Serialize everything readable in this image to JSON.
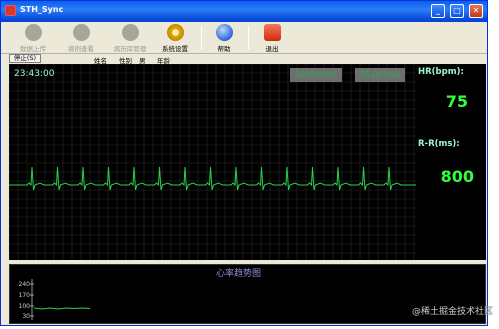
{
  "window": {
    "title": "STH_Sync"
  },
  "toolbar": {
    "items": [
      {
        "label": "数据上传",
        "icon": "upload-icon",
        "enabled": false
      },
      {
        "label": "病例查看",
        "icon": "records-icon",
        "enabled": false
      },
      {
        "label": "病历库管理",
        "icon": "users-icon",
        "enabled": false
      },
      {
        "label": "系统设置",
        "icon": "gear-icon",
        "enabled": true
      },
      {
        "label": "帮助",
        "icon": "help-icon",
        "enabled": true
      },
      {
        "label": "退出",
        "icon": "power-icon",
        "enabled": true
      }
    ]
  },
  "patient": {
    "stop_label": "停止(S)",
    "name_label": "姓名",
    "gender_label": "性别",
    "gender_value": "男",
    "age_label": "年龄"
  },
  "ecg": {
    "time": "23:43:00",
    "sweep_speed": "10mm/mV",
    "paper_speed": "25.0mm/s",
    "trace_color": "#2bd14c",
    "grid_color": "#2a2a2a"
  },
  "vitals": {
    "hr_label": "HR(bpm):",
    "hr_value": "75",
    "rr_label": "R-R(ms):",
    "rr_value": "800"
  },
  "trend": {
    "title": "心率趋势图",
    "y_ticks": [
      "240",
      "170",
      "100",
      "30"
    ],
    "trace_color": "#2bd14c"
  },
  "watermark": "@稀土掘金技术社区",
  "colors": {
    "titlebar": "#0a5fef",
    "panel_bg": "#000000",
    "value_green": "#31ff3d",
    "label_cyan": "#9ff7cf"
  }
}
